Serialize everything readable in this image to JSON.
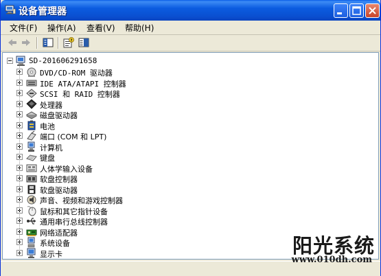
{
  "window": {
    "title": "设备管理器",
    "colors": {
      "titlebar": "#0a5fe8",
      "close": "#c8442a",
      "chrome": "#ece9d8"
    }
  },
  "menu": [
    {
      "label": "文件(F)"
    },
    {
      "label": "操作(A)"
    },
    {
      "label": "查看(V)"
    },
    {
      "label": "帮助(H)"
    }
  ],
  "toolbar": {
    "icons": [
      "back-arrow-icon",
      "forward-arrow-icon",
      "console-tree-icon",
      "properties-icon",
      "help-icon"
    ]
  },
  "tree": {
    "root": {
      "label": "SD-201606291658",
      "icon": "computer-icon"
    },
    "items": [
      {
        "label": "DVD/CD-ROM 驱动器",
        "icon": "cdrom-icon"
      },
      {
        "label": "IDE ATA/ATAPI 控制器",
        "icon": "ide-controller-icon"
      },
      {
        "label": "SCSI 和 RAID 控制器",
        "icon": "scsi-icon"
      },
      {
        "label": "处理器",
        "icon": "processor-icon"
      },
      {
        "label": "磁盘驱动器",
        "icon": "disk-drive-icon"
      },
      {
        "label": "电池",
        "icon": "battery-icon"
      },
      {
        "label": "端口 (COM 和 LPT)",
        "icon": "port-icon"
      },
      {
        "label": "计算机",
        "icon": "computer-node-icon"
      },
      {
        "label": "键盘",
        "icon": "keyboard-icon"
      },
      {
        "label": "人体学输入设备",
        "icon": "hid-icon"
      },
      {
        "label": "软盘控制器",
        "icon": "floppy-controller-icon"
      },
      {
        "label": "软盘驱动器",
        "icon": "floppy-drive-icon"
      },
      {
        "label": "声音、视频和游戏控制器",
        "icon": "sound-icon"
      },
      {
        "label": "鼠标和其它指针设备",
        "icon": "mouse-icon"
      },
      {
        "label": "通用串行总线控制器",
        "icon": "usb-icon"
      },
      {
        "label": "网络适配器",
        "icon": "network-adapter-icon"
      },
      {
        "label": "系统设备",
        "icon": "system-device-icon"
      },
      {
        "label": "显示卡",
        "icon": "display-adapter-icon"
      }
    ]
  },
  "watermark": {
    "title": "阳光系统",
    "url": "www.010dh.com"
  }
}
